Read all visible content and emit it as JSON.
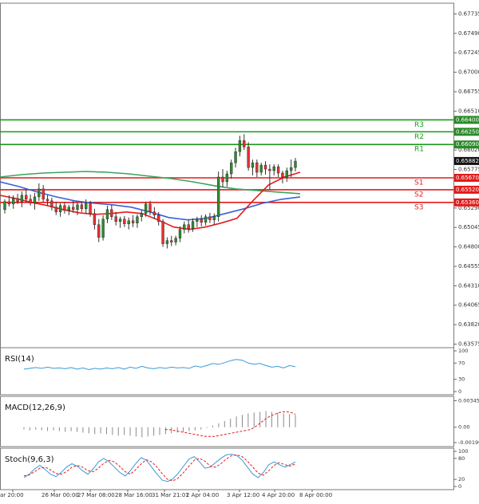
{
  "chart_data": {
    "type": "candlestick",
    "instrument_timeframe": "",
    "colors": {
      "up": "#2e8b2e",
      "down": "#e53030",
      "wick": "#333333",
      "ma_fast": "#e31b1b",
      "ma_mid": "#3a62d6",
      "ma_slow": "#3da35d",
      "pivot_resistance": "#1f9a1f",
      "pivot_support": "#e31b1b",
      "oscillator": "#3a9ad9",
      "signal": "#e31b1b",
      "current_price_bg": "#111111",
      "label_bg": "#e31b1b",
      "label_bg_green": "#2a8a2a"
    },
    "y_axis": {
      "ylim": [
        0.6355,
        0.6783
      ],
      "ticks": [
        "0.67735",
        "0.67490",
        "0.67245",
        "0.67000",
        "0.66755",
        "0.66510",
        "0.66020",
        "0.65775",
        "0.65530",
        "0.65290",
        "0.65045",
        "0.64800",
        "0.64555",
        "0.64310",
        "0.64065",
        "0.63820",
        "0.63575"
      ]
    },
    "x_axis": {
      "ticks": [
        "ar 20:00",
        "26 Mar 00:00",
        "27 Mar 08:00",
        "28 Mar 16:00",
        "31 Mar 21:01",
        "2 Apr 04:00",
        "3 Apr 12:00",
        "4 Apr 20:00",
        "8 Apr 00:00"
      ]
    },
    "current_price": "0.65882",
    "pivots": [
      {
        "name": "R3",
        "value": 0.664,
        "label": "0.66400",
        "kind": "resistance"
      },
      {
        "name": "R2",
        "value": 0.6625,
        "label": "0.66250",
        "kind": "resistance"
      },
      {
        "name": "R1",
        "value": 0.6609,
        "label": "0.66090",
        "kind": "resistance"
      },
      {
        "name": "S1",
        "value": 0.6567,
        "label": "0.65670",
        "kind": "support"
      },
      {
        "name": "S2",
        "value": 0.6552,
        "label": "0.65520",
        "kind": "support"
      },
      {
        "name": "S3",
        "value": 0.6536,
        "label": "0.65360",
        "kind": "support"
      }
    ],
    "candles": [
      {
        "o": 0.6527,
        "h": 0.654,
        "l": 0.6522,
        "c": 0.6537
      },
      {
        "o": 0.6537,
        "h": 0.6545,
        "l": 0.6531,
        "c": 0.6534
      },
      {
        "o": 0.6534,
        "h": 0.6545,
        "l": 0.6528,
        "c": 0.6541
      },
      {
        "o": 0.6541,
        "h": 0.6547,
        "l": 0.6534,
        "c": 0.6537
      },
      {
        "o": 0.6537,
        "h": 0.655,
        "l": 0.653,
        "c": 0.6545
      },
      {
        "o": 0.6545,
        "h": 0.6553,
        "l": 0.6537,
        "c": 0.654
      },
      {
        "o": 0.654,
        "h": 0.6546,
        "l": 0.6532,
        "c": 0.6535
      },
      {
        "o": 0.6535,
        "h": 0.6548,
        "l": 0.6527,
        "c": 0.6543
      },
      {
        "o": 0.6543,
        "h": 0.656,
        "l": 0.6538,
        "c": 0.6553
      },
      {
        "o": 0.6553,
        "h": 0.6558,
        "l": 0.6536,
        "c": 0.654
      },
      {
        "o": 0.654,
        "h": 0.6545,
        "l": 0.6532,
        "c": 0.6538
      },
      {
        "o": 0.6538,
        "h": 0.6542,
        "l": 0.6526,
        "c": 0.653
      },
      {
        "o": 0.653,
        "h": 0.6537,
        "l": 0.652,
        "c": 0.6524
      },
      {
        "o": 0.6524,
        "h": 0.6535,
        "l": 0.6518,
        "c": 0.6532
      },
      {
        "o": 0.6532,
        "h": 0.6536,
        "l": 0.6522,
        "c": 0.6526
      },
      {
        "o": 0.6526,
        "h": 0.6533,
        "l": 0.652,
        "c": 0.653
      },
      {
        "o": 0.653,
        "h": 0.6538,
        "l": 0.6523,
        "c": 0.6527
      },
      {
        "o": 0.6527,
        "h": 0.6536,
        "l": 0.652,
        "c": 0.6533
      },
      {
        "o": 0.6533,
        "h": 0.6537,
        "l": 0.6524,
        "c": 0.6528
      },
      {
        "o": 0.6528,
        "h": 0.654,
        "l": 0.6522,
        "c": 0.6535
      },
      {
        "o": 0.6535,
        "h": 0.6538,
        "l": 0.6518,
        "c": 0.6522
      },
      {
        "o": 0.6522,
        "h": 0.6528,
        "l": 0.6502,
        "c": 0.6508
      },
      {
        "o": 0.6508,
        "h": 0.6515,
        "l": 0.6486,
        "c": 0.6492
      },
      {
        "o": 0.6492,
        "h": 0.652,
        "l": 0.6488,
        "c": 0.6515
      },
      {
        "o": 0.6515,
        "h": 0.6532,
        "l": 0.651,
        "c": 0.6527
      },
      {
        "o": 0.6527,
        "h": 0.6533,
        "l": 0.6514,
        "c": 0.6518
      },
      {
        "o": 0.6518,
        "h": 0.6524,
        "l": 0.6507,
        "c": 0.6512
      },
      {
        "o": 0.6512,
        "h": 0.6518,
        "l": 0.6504,
        "c": 0.6515
      },
      {
        "o": 0.6515,
        "h": 0.6519,
        "l": 0.6505,
        "c": 0.6509
      },
      {
        "o": 0.6509,
        "h": 0.6517,
        "l": 0.6502,
        "c": 0.6513
      },
      {
        "o": 0.6513,
        "h": 0.652,
        "l": 0.6505,
        "c": 0.651
      },
      {
        "o": 0.651,
        "h": 0.6521,
        "l": 0.6504,
        "c": 0.6518
      },
      {
        "o": 0.6518,
        "h": 0.6526,
        "l": 0.6512,
        "c": 0.6522
      },
      {
        "o": 0.6522,
        "h": 0.6537,
        "l": 0.6518,
        "c": 0.6534
      },
      {
        "o": 0.6534,
        "h": 0.6538,
        "l": 0.652,
        "c": 0.6524
      },
      {
        "o": 0.6524,
        "h": 0.653,
        "l": 0.6515,
        "c": 0.652
      },
      {
        "o": 0.652,
        "h": 0.6524,
        "l": 0.6507,
        "c": 0.6512
      },
      {
        "o": 0.6512,
        "h": 0.6515,
        "l": 0.648,
        "c": 0.6484
      },
      {
        "o": 0.6484,
        "h": 0.6492,
        "l": 0.6478,
        "c": 0.6488
      },
      {
        "o": 0.6488,
        "h": 0.6494,
        "l": 0.6481,
        "c": 0.6486
      },
      {
        "o": 0.6486,
        "h": 0.6494,
        "l": 0.6482,
        "c": 0.6491
      },
      {
        "o": 0.6491,
        "h": 0.6506,
        "l": 0.6486,
        "c": 0.6502
      },
      {
        "o": 0.6502,
        "h": 0.6512,
        "l": 0.6497,
        "c": 0.6508
      },
      {
        "o": 0.6508,
        "h": 0.6514,
        "l": 0.6498,
        "c": 0.6503
      },
      {
        "o": 0.6503,
        "h": 0.6516,
        "l": 0.6499,
        "c": 0.6512
      },
      {
        "o": 0.6512,
        "h": 0.6518,
        "l": 0.6505,
        "c": 0.6515
      },
      {
        "o": 0.6515,
        "h": 0.652,
        "l": 0.6506,
        "c": 0.6511
      },
      {
        "o": 0.6511,
        "h": 0.6521,
        "l": 0.6507,
        "c": 0.6518
      },
      {
        "o": 0.6518,
        "h": 0.6523,
        "l": 0.651,
        "c": 0.6514
      },
      {
        "o": 0.6514,
        "h": 0.6522,
        "l": 0.6508,
        "c": 0.6518
      },
      {
        "o": 0.6518,
        "h": 0.6575,
        "l": 0.6512,
        "c": 0.6568
      },
      {
        "o": 0.6568,
        "h": 0.6578,
        "l": 0.6555,
        "c": 0.6562
      },
      {
        "o": 0.6562,
        "h": 0.6576,
        "l": 0.6556,
        "c": 0.6572
      },
      {
        "o": 0.6572,
        "h": 0.659,
        "l": 0.6566,
        "c": 0.6586
      },
      {
        "o": 0.6586,
        "h": 0.6605,
        "l": 0.658,
        "c": 0.66
      },
      {
        "o": 0.66,
        "h": 0.662,
        "l": 0.6594,
        "c": 0.6614
      },
      {
        "o": 0.6614,
        "h": 0.6622,
        "l": 0.6602,
        "c": 0.6606
      },
      {
        "o": 0.6606,
        "h": 0.6612,
        "l": 0.6576,
        "c": 0.658
      },
      {
        "o": 0.658,
        "h": 0.659,
        "l": 0.657,
        "c": 0.6586
      },
      {
        "o": 0.6586,
        "h": 0.659,
        "l": 0.6568,
        "c": 0.6574
      },
      {
        "o": 0.6574,
        "h": 0.6586,
        "l": 0.657,
        "c": 0.6583
      },
      {
        "o": 0.6583,
        "h": 0.6588,
        "l": 0.6571,
        "c": 0.6578
      },
      {
        "o": 0.6578,
        "h": 0.6584,
        "l": 0.6552,
        "c": 0.6576
      },
      {
        "o": 0.6576,
        "h": 0.6584,
        "l": 0.657,
        "c": 0.6581
      },
      {
        "o": 0.6581,
        "h": 0.6584,
        "l": 0.6568,
        "c": 0.6573
      },
      {
        "o": 0.6573,
        "h": 0.6576,
        "l": 0.656,
        "c": 0.6568
      },
      {
        "o": 0.6568,
        "h": 0.658,
        "l": 0.6562,
        "c": 0.6576
      },
      {
        "o": 0.6576,
        "h": 0.659,
        "l": 0.6568,
        "c": 0.658
      },
      {
        "o": 0.658,
        "h": 0.6592,
        "l": 0.6575,
        "c": 0.6588
      }
    ],
    "moving_averages": [
      {
        "color_key": "ma_slow",
        "points": [
          0.6568,
          0.6571,
          0.6573,
          0.6574,
          0.6575,
          0.6574,
          0.6572,
          0.6569,
          0.6566,
          0.6562,
          0.6557,
          0.6553,
          0.6551,
          0.6549,
          0.6547
        ]
      },
      {
        "color_key": "ma_mid",
        "points": [
          0.6562,
          0.6556,
          0.6549,
          0.6543,
          0.6538,
          0.6535,
          0.6533,
          0.653,
          0.6524,
          0.6517,
          0.6514,
          0.6516,
          0.6522,
          0.6528,
          0.6535,
          0.654,
          0.6543
        ]
      },
      {
        "color_key": "ma_fast",
        "points": [
          0.6545,
          0.6541,
          0.6536,
          0.6532,
          0.6527,
          0.6523,
          0.6521,
          0.6522,
          0.6524,
          0.6522,
          0.6514,
          0.6505,
          0.6502,
          0.6505,
          0.651,
          0.6516,
          0.6538,
          0.6558,
          0.6568,
          0.6574
        ]
      }
    ],
    "indicators": [
      {
        "label": "RSI(14)",
        "ticks": [
          "100",
          "70",
          "30",
          "0"
        ],
        "range": [
          0,
          100
        ],
        "series": [
          55,
          57,
          59,
          57,
          60,
          57,
          58,
          56,
          59,
          55,
          58,
          54,
          57,
          55,
          58,
          56,
          59,
          55,
          60,
          57,
          62,
          58,
          56,
          59,
          57,
          60,
          58,
          59,
          57,
          63,
          60,
          64,
          69,
          67,
          71,
          76,
          79,
          77,
          70,
          67,
          69,
          64,
          60,
          62,
          58,
          64,
          61
        ],
        "guide_levels": []
      },
      {
        "label": "MACD(12,26,9)",
        "ticks": [
          "0.003453",
          "0.00",
          "-0.00199"
        ],
        "range": [
          -0.0021,
          0.0036
        ],
        "histogram": [
          -0.0003,
          -0.0004,
          -0.0003,
          -0.0004,
          -0.0005,
          -0.0004,
          -0.0005,
          -0.0006,
          -0.0005,
          -0.0006,
          -0.0007,
          -0.0008,
          -0.0009,
          -0.0008,
          -0.0009,
          -0.001,
          -0.0011,
          -0.001,
          -0.0011,
          -0.0012,
          -0.0013,
          -0.0012,
          -0.0011,
          -0.001,
          -0.0009,
          -0.0008,
          -0.0007,
          -0.0006,
          -0.0005,
          -0.0004,
          -0.0003,
          -0.0001,
          0.0002,
          0.0005,
          0.0008,
          0.0011,
          0.0014,
          0.0016,
          0.0018,
          0.0019,
          0.002,
          0.0021,
          0.002,
          0.0019,
          0.0018,
          0.0017,
          0.0016
        ],
        "signal": [
          -0.0003,
          -0.0003,
          -0.0004,
          -0.0005,
          -0.0006,
          -0.0007,
          -0.0008,
          -0.0009,
          -0.001,
          -0.0011,
          -0.0012,
          -0.0012,
          -0.0012,
          -0.0011,
          -0.001,
          -0.0009,
          -0.0008,
          -0.0007,
          -0.0006,
          -0.0005,
          -0.0004,
          -0.0003,
          0.0,
          0.0004,
          0.0008,
          0.0012,
          0.0015,
          0.0017,
          0.0019,
          0.002,
          0.002,
          0.0019,
          0.0017
        ]
      },
      {
        "label": "Stoch(9,6,3)",
        "ticks": [
          "100",
          "80",
          "20",
          "0"
        ],
        "range": [
          0,
          100
        ],
        "series": [
          25,
          35,
          50,
          60,
          48,
          35,
          28,
          40,
          55,
          65,
          58,
          45,
          35,
          50,
          70,
          80,
          70,
          55,
          40,
          30,
          45,
          65,
          82,
          75,
          55,
          35,
          18,
          14,
          22,
          38,
          58,
          78,
          85,
          70,
          52,
          55,
          68,
          80,
          90,
          92,
          88,
          75,
          55,
          35,
          25,
          40,
          62,
          70,
          62,
          55,
          62,
          70
        ],
        "signal": [
          30,
          33,
          42,
          52,
          55,
          47,
          37,
          35,
          42,
          55,
          60,
          55,
          45,
          42,
          52,
          66,
          74,
          70,
          57,
          42,
          35,
          48,
          64,
          76,
          70,
          55,
          36,
          20,
          16,
          24,
          40,
          58,
          75,
          80,
          72,
          58,
          55,
          65,
          78,
          88,
          90,
          85,
          72,
          55,
          38,
          32,
          45,
          60,
          68,
          62,
          58,
          64
        ]
      }
    ]
  }
}
